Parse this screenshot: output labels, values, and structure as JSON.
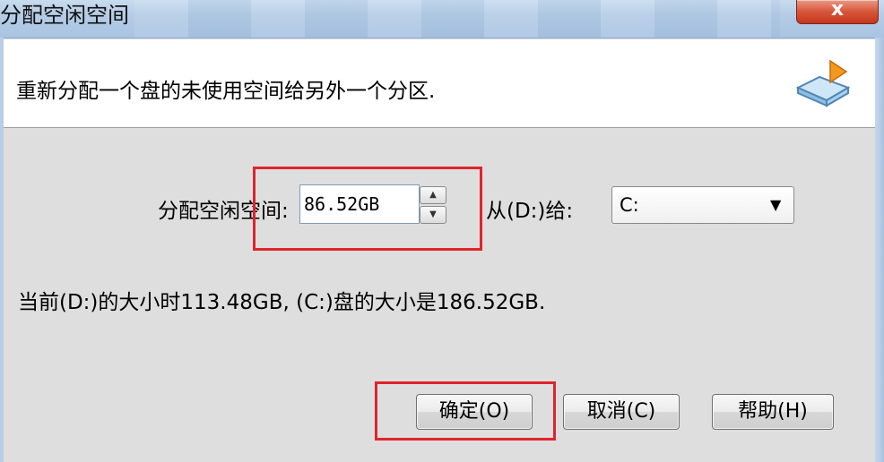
{
  "window": {
    "title": "分配空闲空间",
    "close_glyph": "x"
  },
  "header": {
    "description": "重新分配一个盘的未使用空间给另外一个分区."
  },
  "form": {
    "allocate_label": "分配空闲空间:",
    "allocate_value": "86.52GB",
    "from_label": "从(D:)给:",
    "target_drive": "C:",
    "info_text": "当前(D:)的大小时113.48GB, (C:)盘的大小是186.52GB."
  },
  "buttons": {
    "ok": "确定(O)",
    "cancel": "取消(C)",
    "help": "帮助(H)"
  },
  "colors": {
    "highlight": "#e0242b",
    "titlebar": "#b4cce6"
  },
  "icons": {
    "header": "drive-arrow-icon",
    "spin_up": "triangle-up-icon",
    "spin_down": "triangle-down-icon",
    "dropdown": "triangle-down-icon"
  }
}
